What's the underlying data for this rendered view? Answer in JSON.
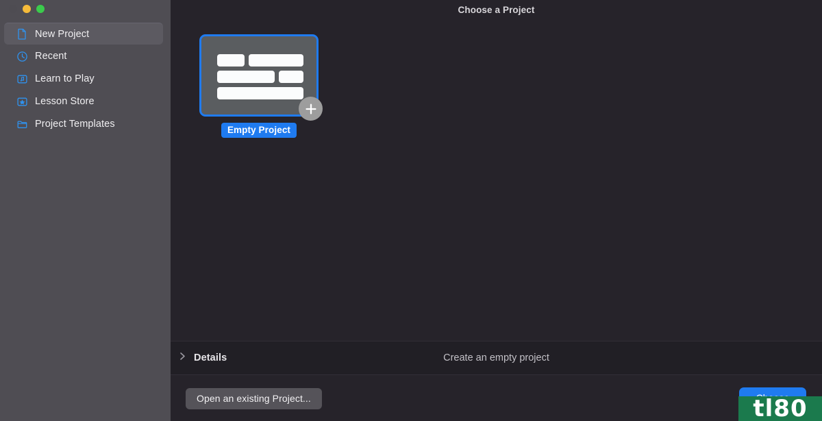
{
  "window": {
    "traffic_lights": [
      {
        "name": "close",
        "color": "#4e4c52"
      },
      {
        "name": "minimize",
        "color": "#f6bb3a"
      },
      {
        "name": "zoom",
        "color": "#3bcb4c"
      }
    ]
  },
  "sidebar": {
    "items": [
      {
        "label": "New Project",
        "icon": "document-icon",
        "selected": true
      },
      {
        "label": "Recent",
        "icon": "clock-icon",
        "selected": false
      },
      {
        "label": "Learn to Play",
        "icon": "music-note-icon",
        "selected": false
      },
      {
        "label": "Lesson Store",
        "icon": "star-icon",
        "selected": false
      },
      {
        "label": "Project Templates",
        "icon": "folder-icon",
        "selected": false
      }
    ]
  },
  "header": {
    "title": "Choose a Project"
  },
  "main": {
    "project": {
      "label": "Empty Project",
      "badge_icon": "plus-icon",
      "selected": true
    }
  },
  "details": {
    "toggle_label": "Details",
    "chevron_icon": "chevron-right-icon",
    "description": "Create an empty project",
    "expanded": false
  },
  "footer": {
    "open_existing_label": "Open an existing Project...",
    "choose_label": "Choose"
  },
  "watermark": {
    "text": "tl80",
    "background": "#1b7a4d"
  },
  "colors": {
    "accent": "#1f7bf0",
    "sidebar": "#4f4d53",
    "background": "#26232a"
  }
}
